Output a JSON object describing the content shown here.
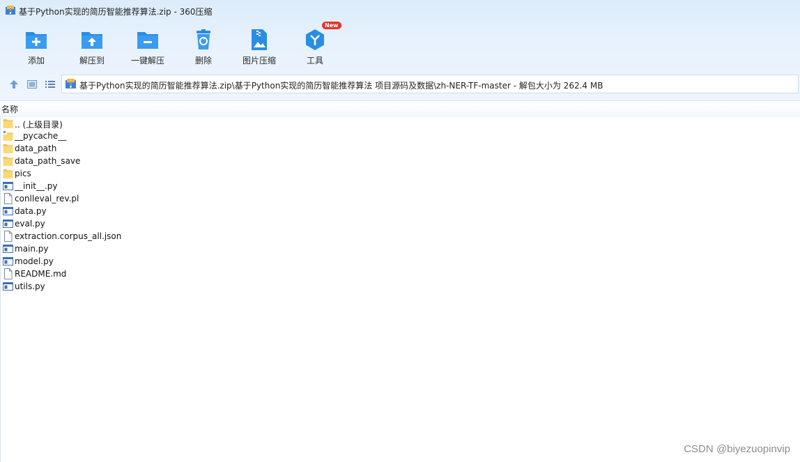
{
  "window": {
    "title": "基于Python实现的简历智能推荐算法.zip - 360压缩"
  },
  "toolbar": {
    "items": [
      {
        "label": "添加",
        "icon": "add-folder-icon"
      },
      {
        "label": "解压到",
        "icon": "extract-to-icon"
      },
      {
        "label": "一键解压",
        "icon": "one-click-extract-icon"
      },
      {
        "label": "删除",
        "icon": "delete-icon"
      },
      {
        "label": "图片压缩",
        "icon": "image-compress-icon"
      },
      {
        "label": "工具",
        "icon": "tools-icon",
        "badge": "New"
      }
    ]
  },
  "navbar": {
    "path": "基于Python实现的简历智能推荐算法.zip\\基于Python实现的简历智能推荐算法 项目源码及数据\\zh-NER-TF-master - 解包大小为 262.4 MB"
  },
  "list": {
    "column_header": "名称",
    "files": [
      {
        "name": ".. (上级目录)",
        "type": "folder"
      },
      {
        "name": "__pycache__",
        "type": "folder"
      },
      {
        "name": "data_path",
        "type": "folder"
      },
      {
        "name": "data_path_save",
        "type": "folder"
      },
      {
        "name": "pics",
        "type": "folder"
      },
      {
        "name": "__init__.py",
        "type": "py"
      },
      {
        "name": "conlleval_rev.pl",
        "type": "file"
      },
      {
        "name": "data.py",
        "type": "py"
      },
      {
        "name": "eval.py",
        "type": "py"
      },
      {
        "name": "extraction.corpus_all.json",
        "type": "file"
      },
      {
        "name": "main.py",
        "type": "py"
      },
      {
        "name": "model.py",
        "type": "py"
      },
      {
        "name": "README.md",
        "type": "file"
      },
      {
        "name": "utils.py",
        "type": "py"
      }
    ]
  },
  "watermark": "CSDN @biyezuopinvip",
  "colors": {
    "accent": "#2a8de4",
    "folder": "#f7d46b",
    "badge": "#e8322d"
  }
}
